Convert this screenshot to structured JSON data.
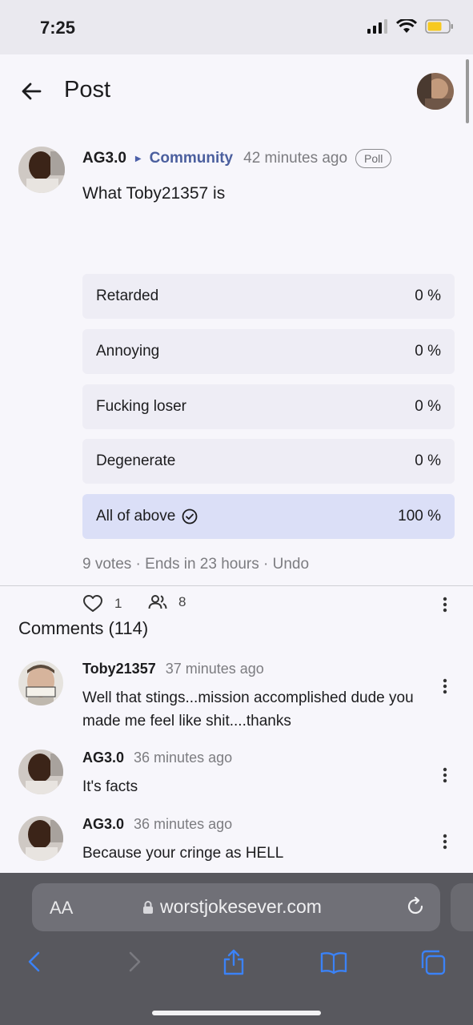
{
  "status_bar": {
    "time": "7:25"
  },
  "header": {
    "title": "Post"
  },
  "post": {
    "author": "AG3.0",
    "community": "Community",
    "time": "42 minutes ago",
    "badge": "Poll",
    "title": "What Toby21357 is",
    "options": [
      {
        "label": "Retarded",
        "percent": "0 %"
      },
      {
        "label": "Annoying",
        "percent": "0 %"
      },
      {
        "label": "Fucking loser",
        "percent": "0 %"
      },
      {
        "label": "Degenerate",
        "percent": "0 %"
      },
      {
        "label": "All of above",
        "percent": "100 %",
        "selected": true
      }
    ],
    "footer": {
      "votes": "9 votes",
      "ends": "Ends in 23 hours",
      "undo": "Undo"
    },
    "likes": "1",
    "participants": "8"
  },
  "comments": {
    "title": "Comments (114)",
    "items": [
      {
        "author": "Toby21357",
        "time": "37 minutes ago",
        "text": "Well that stings...mission accomplished dude you made me feel like shit....thanks"
      },
      {
        "author": "AG3.0",
        "time": "36 minutes ago",
        "text": "It's facts"
      },
      {
        "author": "AG3.0",
        "time": "36 minutes ago",
        "text": "Because your cringe as HELL"
      }
    ]
  },
  "browser": {
    "text_size": "AA",
    "url": "worstjokesever.com"
  },
  "colors": {
    "accent": "#4b5f9e",
    "selected_option": "#dbdff7",
    "safari_blue": "#3b82f6"
  }
}
